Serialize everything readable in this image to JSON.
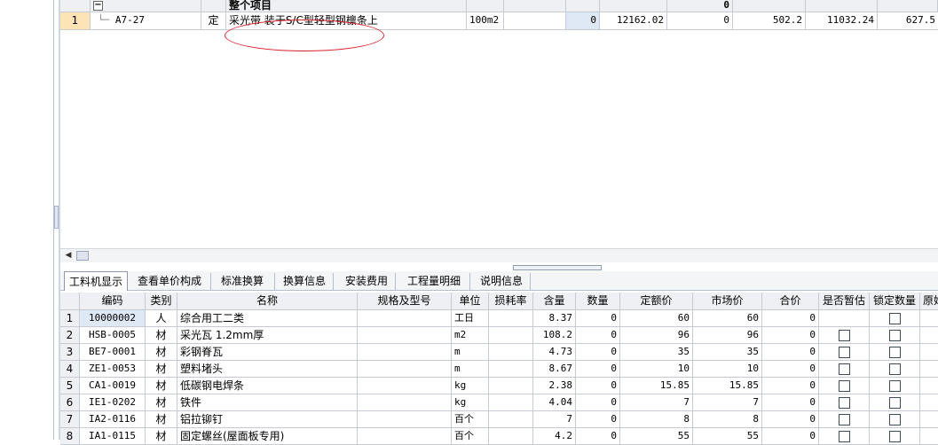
{
  "top_grid": {
    "header_row": {
      "summary_name": "整个项目",
      "zero_value": "0"
    },
    "rows": [
      {
        "index": "1",
        "code": "A7-27",
        "type": "定",
        "name": "采光带 装于S/C型轻型钢檩条上",
        "unit": "100m2",
        "qty": "0",
        "base_price": "12162.02",
        "qty2": "0",
        "amount1": "502.2",
        "amount2": "11032.24",
        "amount3": "627.5"
      }
    ]
  },
  "tabs": [
    {
      "label": "工料机显示",
      "active": true
    },
    {
      "label": "查看单价构成",
      "active": false
    },
    {
      "label": "标准换算",
      "active": false
    },
    {
      "label": "换算信息",
      "active": false
    },
    {
      "label": "安装费用",
      "active": false
    },
    {
      "label": "工程量明细",
      "active": false
    },
    {
      "label": "说明信息",
      "active": false
    }
  ],
  "bottom_grid": {
    "headers": [
      "编码",
      "类别",
      "名称",
      "规格及型号",
      "单位",
      "损耗率",
      "含量",
      "数量",
      "定额价",
      "市场价",
      "合价",
      "是否暂估",
      "锁定数量",
      "原始"
    ],
    "rows": [
      {
        "n": "1",
        "code": "10000002",
        "cat": "人",
        "name": "综合用工二类",
        "unit": "工日",
        "content": "8.37",
        "qty": "0",
        "quota": "60",
        "market": "60",
        "total": "0",
        "checks": false
      },
      {
        "n": "2",
        "code": "HSB-0005",
        "cat": "材",
        "name": "采光瓦 1.2mm厚",
        "unit": "m2",
        "content": "108.2",
        "qty": "0",
        "quota": "96",
        "market": "96",
        "total": "0",
        "checks": true
      },
      {
        "n": "3",
        "code": "BE7-0001",
        "cat": "材",
        "name": "彩钢脊瓦",
        "unit": "m",
        "content": "4.73",
        "qty": "0",
        "quota": "35",
        "market": "35",
        "total": "0",
        "checks": true
      },
      {
        "n": "4",
        "code": "ZE1-0053",
        "cat": "材",
        "name": "塑料堵头",
        "unit": "m",
        "content": "8.67",
        "qty": "0",
        "quota": "10",
        "market": "10",
        "total": "0",
        "checks": true
      },
      {
        "n": "5",
        "code": "CA1-0019",
        "cat": "材",
        "name": "低碳钢电焊条",
        "unit": "kg",
        "content": "2.38",
        "qty": "0",
        "quota": "15.85",
        "market": "15.85",
        "total": "0",
        "checks": true
      },
      {
        "n": "6",
        "code": "IE1-0202",
        "cat": "材",
        "name": "铁件",
        "unit": "kg",
        "content": "4.04",
        "qty": "0",
        "quota": "7",
        "market": "7",
        "total": "0",
        "checks": true
      },
      {
        "n": "7",
        "code": "IA2-0116",
        "cat": "材",
        "name": "铝拉铆钉",
        "unit": "百个",
        "content": "7",
        "qty": "0",
        "quota": "8",
        "market": "8",
        "total": "0",
        "checks": true
      },
      {
        "n": "8",
        "code": "IA1-0115",
        "cat": "材",
        "name": "固定螺丝(屋面板专用)",
        "unit": "百个",
        "content": "4.2",
        "qty": "0",
        "quota": "55",
        "market": "55",
        "total": "0",
        "checks": true
      }
    ]
  },
  "colors": {
    "annotation_oval": "#d9202a",
    "selected_rownum": "#fce4b6",
    "header_bg": "#eef0f4"
  }
}
